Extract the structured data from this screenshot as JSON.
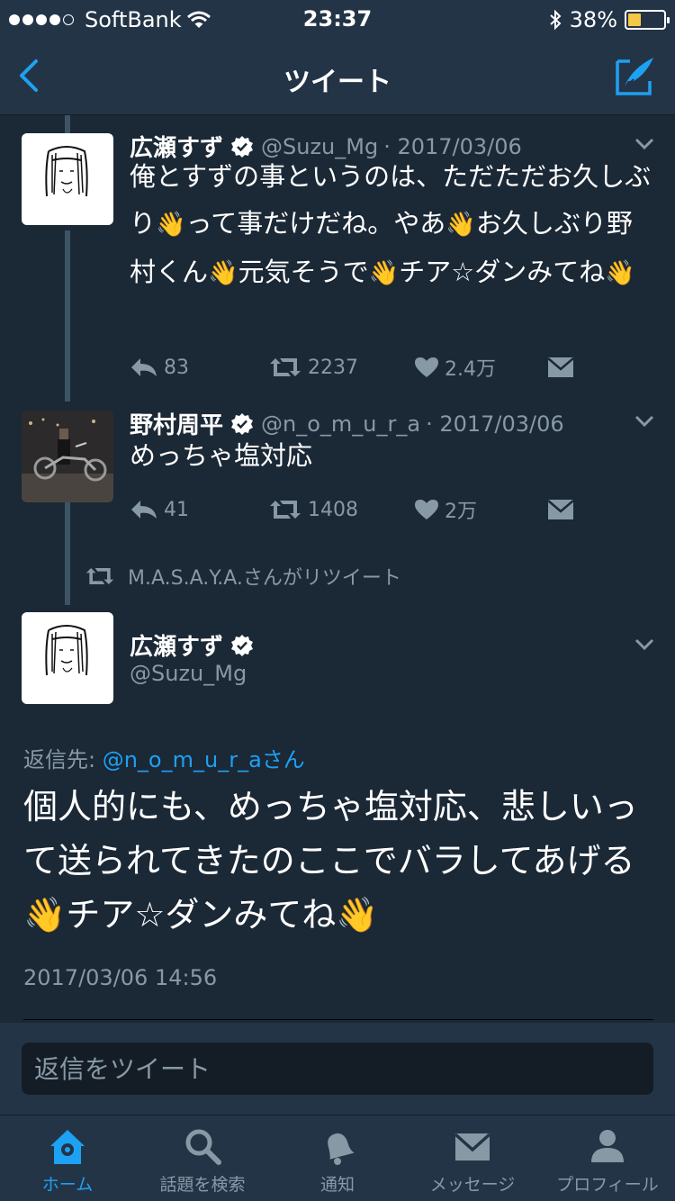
{
  "status_bar": {
    "carrier": "SoftBank",
    "time": "23:37",
    "battery": "38%",
    "battery_level": 0.38
  },
  "nav": {
    "title": "ツイート",
    "back_icon": "chevron-left-icon",
    "compose_icon": "compose-icon"
  },
  "tweets": [
    {
      "name": "広瀬すず",
      "handle": "@Suzu_Mg",
      "date": "· 2017/03/06",
      "text_parts": [
        "俺とすずの事というのは、ただただお久しぶり",
        "👋",
        "って事だけだね。やあ",
        "👋",
        "お久しぶり野村くん",
        "👋",
        "元気そうで",
        "👋",
        "チア☆ダンみてね",
        "👋"
      ],
      "replies": "83",
      "retweets": "2237",
      "likes": "2.4万"
    },
    {
      "name": "野村周平",
      "handle": "@n_o_m_u_r_a",
      "date": "· 2017/03/06",
      "text": "めっちゃ塩対応",
      "replies": "41",
      "retweets": "1408",
      "likes": "2万"
    }
  ],
  "retweeted_by": "M.A.S.A.Y.A.さんがリツイート",
  "main_tweet": {
    "name": "広瀬すず",
    "handle": "@Suzu_Mg",
    "reply_to_label": "返信先: ",
    "reply_to_mention": "@n_o_m_u_r_a",
    "reply_to_suffix": "さん",
    "text_parts": [
      "個人的にも、めっちゃ塩対応、悲しいって送られてきたのここでバラしてあげる",
      "👋",
      "チア☆ダンみてね",
      "👋"
    ],
    "timestamp": "2017/03/06 14:56"
  },
  "reply_box": {
    "placeholder": "返信をツイート"
  },
  "tabs": [
    {
      "label": "ホーム",
      "icon": "home-icon",
      "active": true
    },
    {
      "label": "話題を検索",
      "icon": "search-icon",
      "active": false
    },
    {
      "label": "通知",
      "icon": "bell-icon",
      "active": false
    },
    {
      "label": "メッセージ",
      "icon": "envelope-icon",
      "active": false
    },
    {
      "label": "プロフィール",
      "icon": "person-icon",
      "active": false
    }
  ],
  "colors": {
    "background": "#1b2836",
    "bar": "#243447",
    "accent": "#1da1f2",
    "muted": "#8899a6"
  }
}
